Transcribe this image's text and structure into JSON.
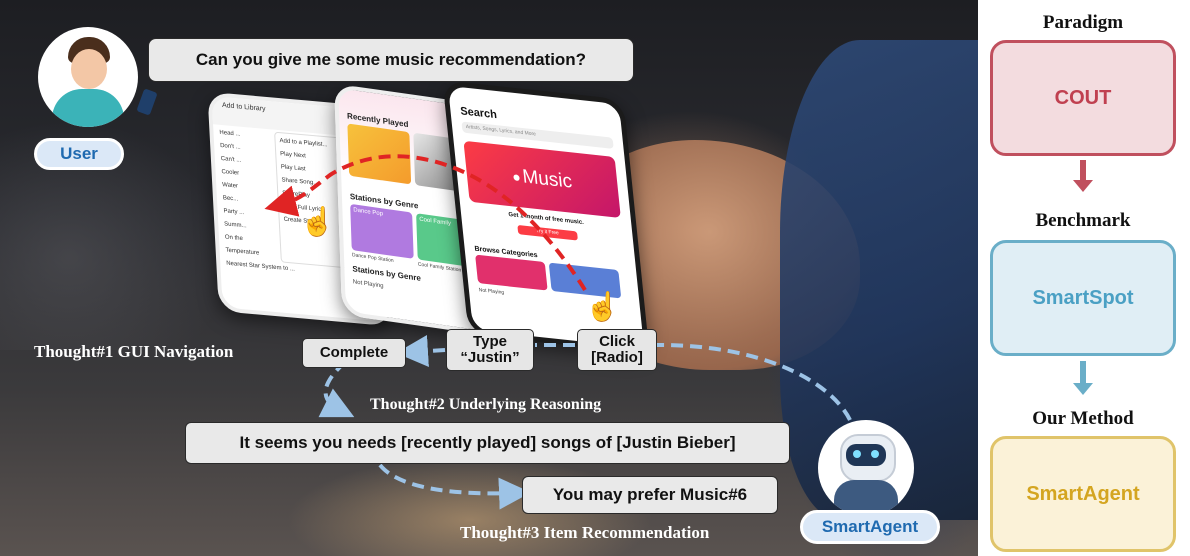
{
  "scene": {
    "user_question": "Can you give me some music recommendation?",
    "user_label": "User",
    "agent_label": "SmartAgent",
    "thought1": "Thought#1 GUI Navigation",
    "thought2": "Thought#2 Underlying Reasoning",
    "thought3": "Thought#3 Item Recommendation",
    "complete_box": "Complete",
    "type_box": "Type\n“Justin”",
    "click_box": "Click\n[Radio]",
    "reasoning_bubble": "It seems you needs [recently played] songs of [Justin Bieber]",
    "recommendation_bubble": "You may prefer Music#6"
  },
  "phones": {
    "left": {
      "header": "Add to Library",
      "menu_items": [
        "Add to a Playlist...",
        "Play Next",
        "Play Last",
        "Share Song...",
        "SharePlay",
        "View Full Lyrics",
        "Create Station"
      ],
      "song_list": [
        "Head ...",
        "Don't ...",
        "Can't ...",
        "Cooler",
        "Water",
        "Bec...",
        "Party ...",
        "Summ...",
        "On the",
        "Temperature",
        "Nearest Star System to ..."
      ]
    },
    "middle": {
      "recently_played": "Recently Played",
      "stations_by_genre": "Stations by Genre",
      "stations_by_genre_2": "Stations by Genre",
      "dance_pop": "Dance Pop",
      "cool_family": "Cool Family",
      "dance_pop_station": "Dance Pop Station",
      "cool_family_station": "Cool Family Station",
      "not_playing": "Not Playing"
    },
    "right": {
      "search_title": "Search",
      "search_placeholder": "Artists, Songs, Lyrics, and More",
      "brand": "Music",
      "promo": "Get 1 month of free music.",
      "try_button": "Try it Free",
      "categories": "Browse Categories",
      "not_playing": "Not Playing"
    }
  },
  "sidebar": {
    "paradigm_title": "Paradigm",
    "paradigm_box": "COUT",
    "benchmark_title": "Benchmark",
    "benchmark_box": "SmartSpot",
    "method_title": "Our Method",
    "method_box": "SmartAgent"
  },
  "colors": {
    "cout_border": "#c0505e",
    "cout_fill": "#f3dcdf",
    "cout_text": "#c04050",
    "spot_border": "#6aaec8",
    "spot_fill": "#e0eef5",
    "spot_text": "#4aa0c4",
    "agent_border": "#e0c46a",
    "agent_fill": "#fbf2d8",
    "agent_text": "#d4a520",
    "arrow_red": "#c0505e",
    "arrow_blue": "#6aaec8",
    "pill_fill": "#dbe8f7",
    "pill_text": "#1f6ab0",
    "dash_blue": "#9dc3e6",
    "dash_red": "#e02424"
  }
}
